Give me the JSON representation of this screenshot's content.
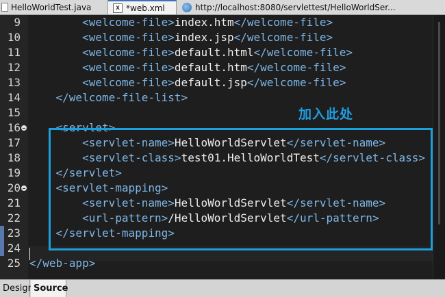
{
  "tabs": [
    {
      "label": "HelloWorldTest.java",
      "icon": "java-file-icon"
    },
    {
      "label": "*web.xml",
      "icon": "xml-file-icon",
      "icon_glyph": "x"
    },
    {
      "label": "http://localhost:8080/servlettest/HelloWorldSer...",
      "icon": "globe-icon"
    }
  ],
  "editor": {
    "lines": [
      {
        "num": "9",
        "indent": "        ",
        "tag_open": "<welcome-file>",
        "text": "index.htm",
        "tag_close": "</welcome-file>"
      },
      {
        "num": "10",
        "indent": "        ",
        "tag_open": "<welcome-file>",
        "text": "index.jsp",
        "tag_close": "</welcome-file>"
      },
      {
        "num": "11",
        "indent": "        ",
        "tag_open": "<welcome-file>",
        "text": "default.html",
        "tag_close": "</welcome-file>"
      },
      {
        "num": "12",
        "indent": "        ",
        "tag_open": "<welcome-file>",
        "text": "default.htm",
        "tag_close": "</welcome-file>"
      },
      {
        "num": "13",
        "indent": "        ",
        "tag_open": "<welcome-file>",
        "text": "default.jsp",
        "tag_close": "</welcome-file>"
      },
      {
        "num": "14",
        "indent": "    ",
        "tag_open": "</welcome-file-list>",
        "text": "",
        "tag_close": ""
      },
      {
        "num": "15",
        "indent": "",
        "tag_open": "",
        "text": "",
        "tag_close": ""
      },
      {
        "num": "16",
        "indent": "    ",
        "tag_open": "<servlet>",
        "text": "",
        "tag_close": ""
      },
      {
        "num": "17",
        "indent": "        ",
        "tag_open": "<servlet-name>",
        "text": "HelloWorldServlet",
        "tag_close": "</servlet-name>"
      },
      {
        "num": "18",
        "indent": "        ",
        "tag_open": "<servlet-class>",
        "text": "test01.HelloWorldTest",
        "tag_close": "</servlet-class>"
      },
      {
        "num": "19",
        "indent": "    ",
        "tag_open": "</servlet>",
        "text": "",
        "tag_close": ""
      },
      {
        "num": "20",
        "indent": "    ",
        "tag_open": "<servlet-mapping>",
        "text": "",
        "tag_close": ""
      },
      {
        "num": "21",
        "indent": "        ",
        "tag_open": "<servlet-name>",
        "text": "HelloWorldServlet",
        "tag_close": "</servlet-name>"
      },
      {
        "num": "22",
        "indent": "        ",
        "tag_open": "<url-pattern>",
        "text": "/HelloWorldServlet",
        "tag_close": "</url-pattern>"
      },
      {
        "num": "23",
        "indent": "    ",
        "tag_open": "</servlet-mapping>",
        "text": "",
        "tag_close": ""
      },
      {
        "num": "24",
        "indent": "",
        "tag_open": "",
        "text": "",
        "tag_close": ""
      },
      {
        "num": "25",
        "indent": "",
        "tag_open": "</web-app>",
        "text": "",
        "tag_close": ""
      }
    ],
    "fold_markers_on": [
      "16",
      "20"
    ],
    "changed_lines": [
      "23",
      "24"
    ]
  },
  "annotation": {
    "text": "加入此处",
    "color": "#1e9ee2"
  },
  "bottom_tabs": [
    {
      "label": "Design",
      "active": false
    },
    {
      "label": "Source",
      "active": true
    }
  ],
  "colors": {
    "tag": "#7fb7e8",
    "text": "#eeeeee",
    "background": "#1e1e1e",
    "highlight_box": "#1b9fdd"
  }
}
